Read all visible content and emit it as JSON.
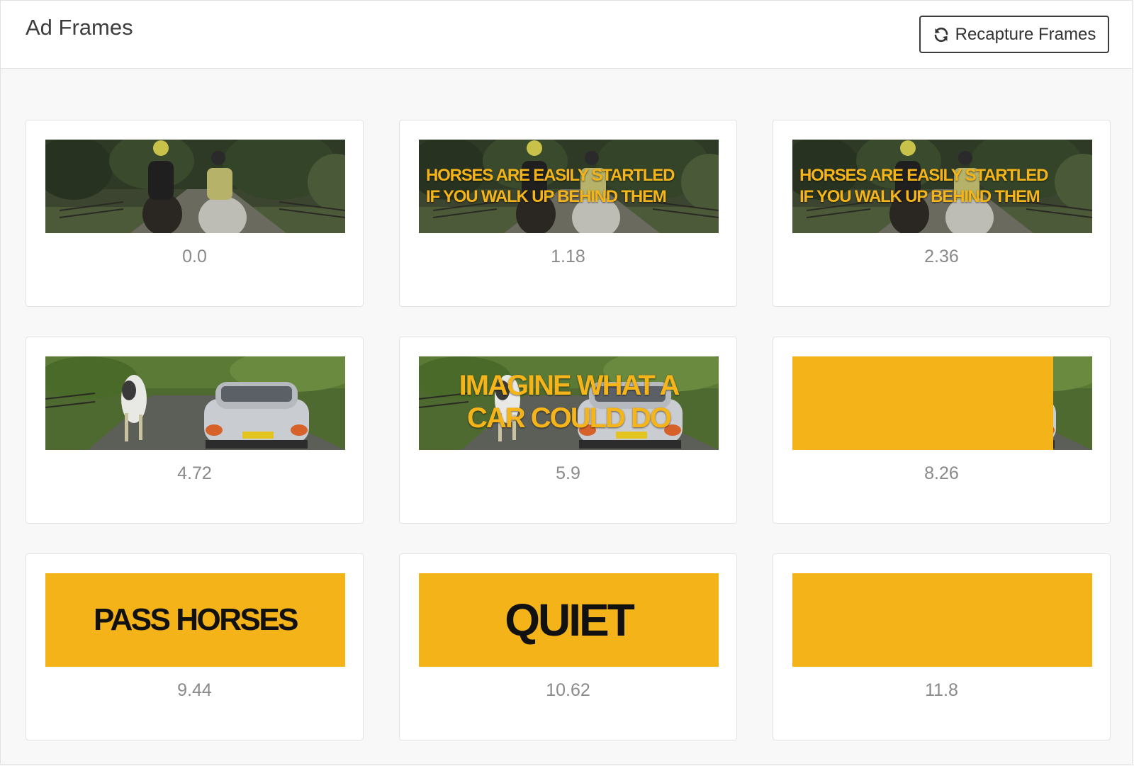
{
  "header": {
    "title": "Ad Frames",
    "recapture_label": "Recapture Frames",
    "recapture_icon": "refresh-icon"
  },
  "colors": {
    "accent_yellow": "#f4b318",
    "caption_yellow": "#f5b41a"
  },
  "frames": [
    {
      "timestamp": "0.0",
      "scene": "horses-rear",
      "caption": []
    },
    {
      "timestamp": "1.18",
      "scene": "horses-rear",
      "caption": [
        "HORSES ARE EASILY STARTLED",
        "IF YOU WALK UP BEHIND THEM"
      ]
    },
    {
      "timestamp": "2.36",
      "scene": "horses-rear",
      "caption": [
        "HORSES ARE EASILY STARTLED",
        "IF YOU WALK UP BEHIND THEM"
      ]
    },
    {
      "timestamp": "4.72",
      "scene": "car-passing",
      "caption": []
    },
    {
      "timestamp": "5.9",
      "scene": "car-passing",
      "caption": [
        "IMAGINE WHAT A",
        "CAR COULD DO"
      ]
    },
    {
      "timestamp": "8.26",
      "scene": "car-passing",
      "caption": [],
      "yellow_fill": 0.87
    },
    {
      "timestamp": "9.44",
      "scene": "yellow",
      "big_text": "PASS HORSES"
    },
    {
      "timestamp": "10.62",
      "scene": "yellow",
      "big_text": "QUIET"
    },
    {
      "timestamp": "11.8",
      "scene": "yellow",
      "big_text": ""
    }
  ]
}
